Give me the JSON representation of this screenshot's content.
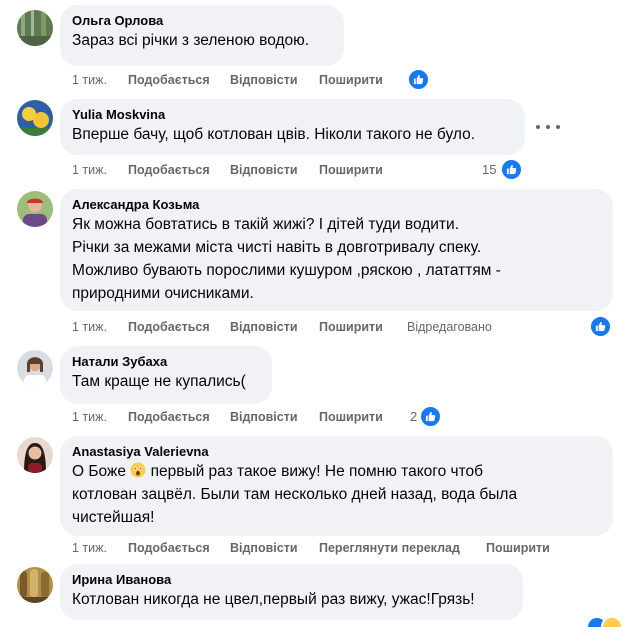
{
  "actions": {
    "like": "Подобається",
    "reply": "Відповісти",
    "share": "Поширити",
    "translate": "Переглянути переклад",
    "edited": "Відредаговано"
  },
  "comments": [
    {
      "author": "Ольга Орлова",
      "text": "Зараз всі річки з зеленою водою.",
      "time": "1 тиж."
    },
    {
      "author": "Yulia Moskvina",
      "text": "Вперше бачу, щоб котлован цвів. Ніколи такого не було.",
      "time": "1 тиж.",
      "reactions": "15"
    },
    {
      "author": "Александра Козьма",
      "text": "Як можна бовтатись в такій жижі? І дітей туди водити.\nРічки за межами міста чисті навіть в довготривалу спеку.\nМожливо бувають порослими кушуром ,ряскою , лататтям -\nприродними очисниками.",
      "time": "1 тиж."
    },
    {
      "author": "Натали Зубаха",
      "text": "Там краще не купались(",
      "time": "1 тиж.",
      "reactions": "2"
    },
    {
      "author": "Anastasiya Valerievna",
      "text_before_emoji": "О Боже ",
      "text_after_emoji": " первый раз такое вижу! Не помню такого чтоб\nкотлован зацвёл. Были там несколько дней назад, вода была\nчистейшая!",
      "time": "1 тиж."
    },
    {
      "author": "Ирина Иванова",
      "text": "Котлован никогда не цвел,первый раз вижу, ужас!Грязь!"
    }
  ],
  "icons": {
    "like_badge": "thumbs-up-icon",
    "more": "more-options-icon",
    "emoji": "astonished-face-emoji"
  },
  "colors": {
    "bubble": "#f0f2f5",
    "like_blue": "#1877f2",
    "meta": "#65676b",
    "text": "#050505"
  }
}
